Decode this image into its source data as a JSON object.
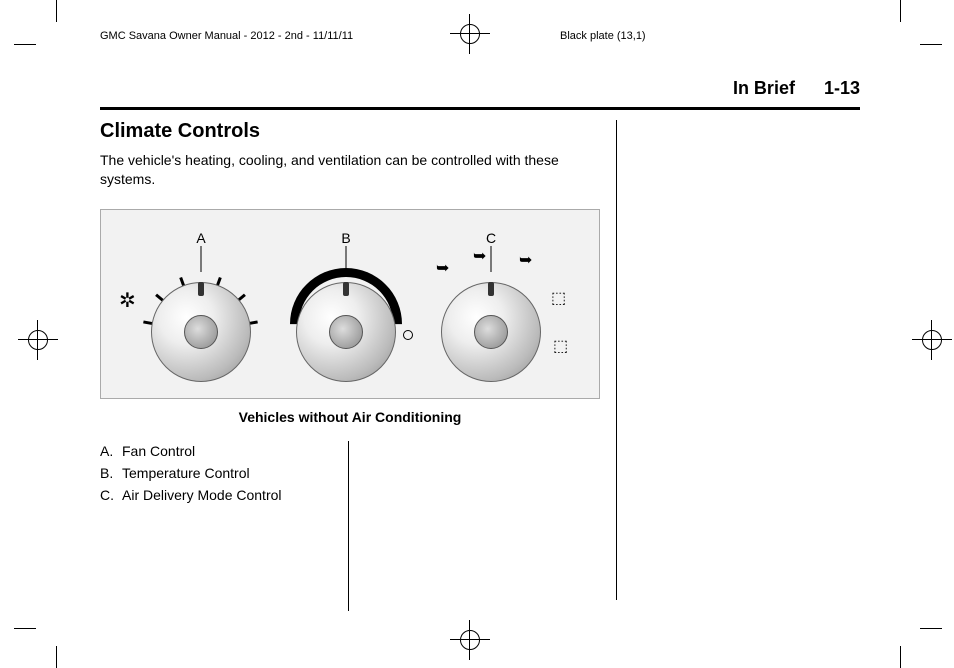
{
  "meta": {
    "doc_title": "GMC Savana Owner Manual - 2012 - 2nd - 11/11/11",
    "plate": "Black plate (13,1)"
  },
  "header": {
    "section": "In Brief",
    "page": "1-13"
  },
  "section": {
    "title": "Climate Controls",
    "intro": "The vehicle's heating, cooling, and ventilation can be controlled with these systems."
  },
  "figure": {
    "labels": {
      "a": "A",
      "b": "B",
      "c": "C"
    },
    "caption": "Vehicles without Air Conditioning"
  },
  "legend": [
    {
      "letter": "A.",
      "text": "Fan Control"
    },
    {
      "letter": "B.",
      "text": "Temperature Control"
    },
    {
      "letter": "C.",
      "text": "Air Delivery Mode Control"
    }
  ]
}
